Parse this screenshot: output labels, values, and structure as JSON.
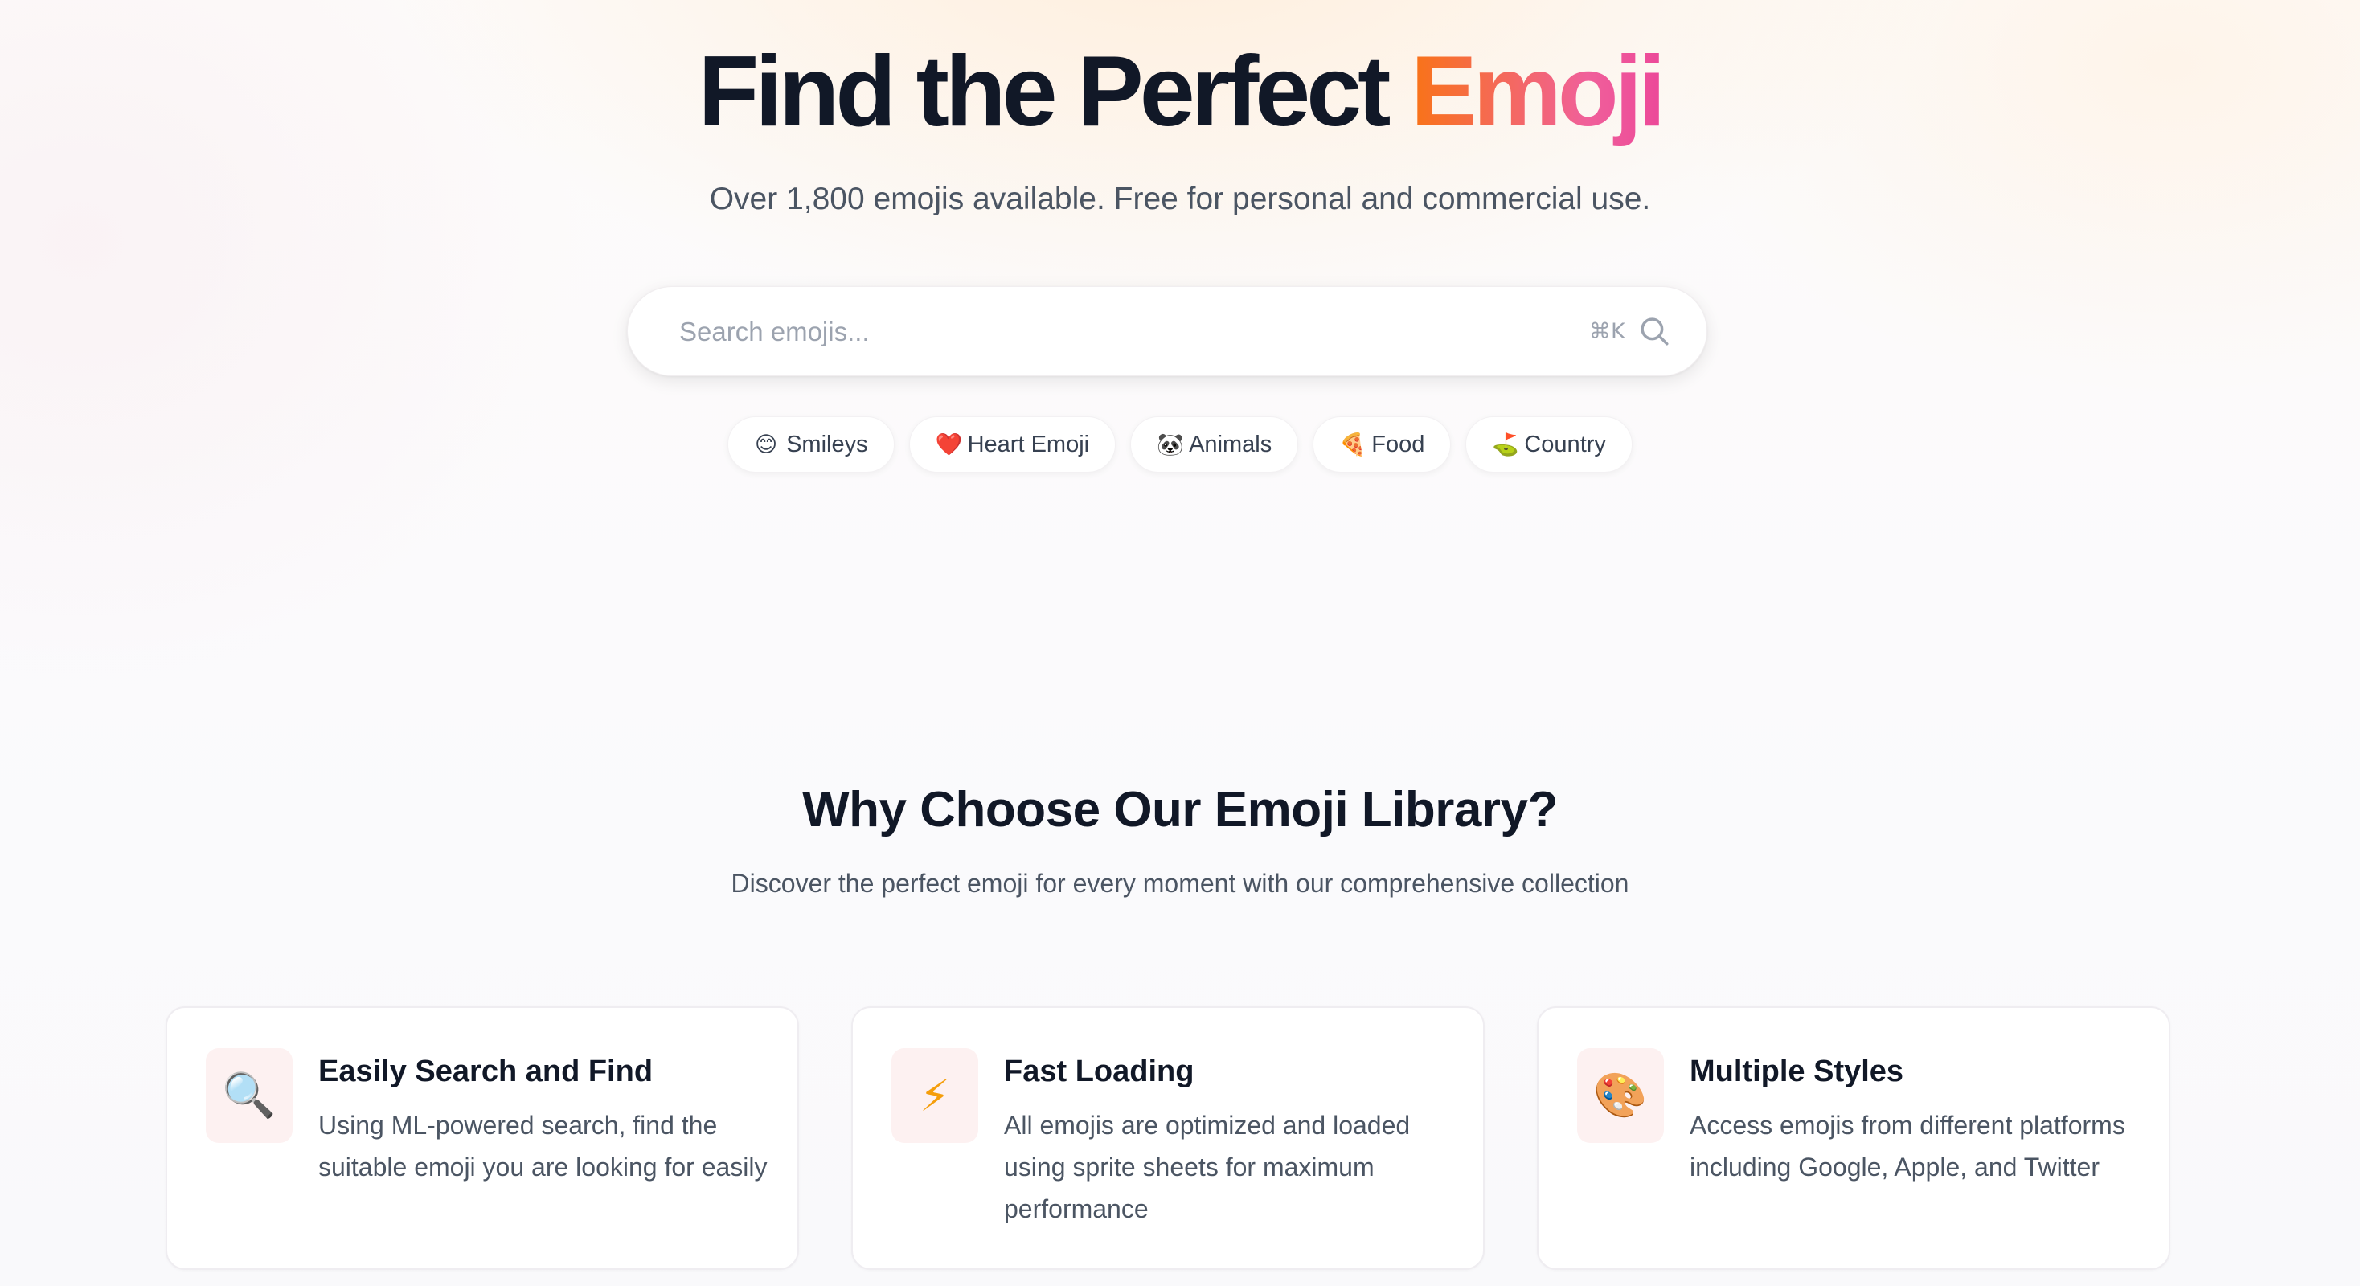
{
  "hero": {
    "title_main": "Find the Perfect ",
    "title_accent": "Emoji",
    "subtitle": "Over 1,800 emojis available. Free for personal and commercial use."
  },
  "search": {
    "placeholder": "Search emojis...",
    "shortcut": "⌘K"
  },
  "categories": [
    {
      "emoji": "😊",
      "label": "Smileys"
    },
    {
      "emoji": "❤️",
      "label": "Heart Emoji"
    },
    {
      "emoji": "🐼",
      "label": "Animals"
    },
    {
      "emoji": "🍕",
      "label": "Food"
    },
    {
      "emoji": "⛳",
      "label": "Country"
    }
  ],
  "why": {
    "title": "Why Choose Our Emoji Library?",
    "subtitle": "Discover the perfect emoji for every moment with our comprehensive collection"
  },
  "features": [
    {
      "icon": "🔍",
      "title": "Easily Search and Find",
      "description": "Using ML-powered search, find the suitable emoji you are looking for easily"
    },
    {
      "icon": "⚡",
      "title": "Fast Loading",
      "description": "All emojis are optimized and loaded using sprite sheets for maximum performance"
    },
    {
      "icon": "🎨",
      "title": "Multiple Styles",
      "description": "Access emojis from different platforms including Google, Apple, and Twitter"
    }
  ],
  "colors": {
    "accent_start": "#f97316",
    "accent_end": "#ec4899",
    "heading": "#111827",
    "body_text": "#4b5563"
  }
}
